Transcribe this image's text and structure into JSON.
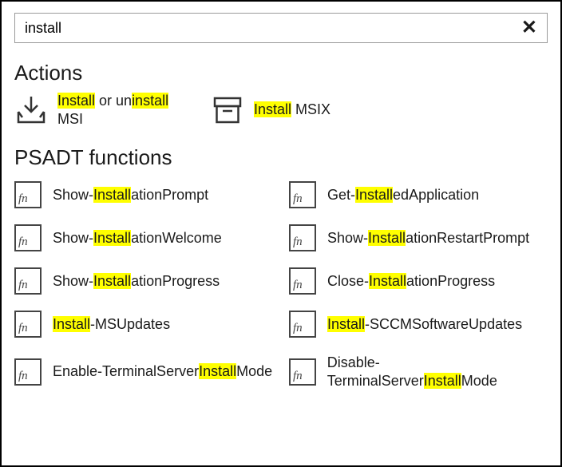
{
  "search": {
    "value": "install",
    "clear_glyph": "✕"
  },
  "sections": {
    "actions_title": "Actions",
    "functions_title": "PSADT functions"
  },
  "highlight": "install",
  "actions": [
    {
      "label": "Install or uninstall MSI",
      "icon": "tray-download-icon"
    },
    {
      "label": "Install MSIX",
      "icon": "archive-box-icon"
    }
  ],
  "functions": [
    {
      "label": "Show-InstallationPrompt"
    },
    {
      "label": "Get-InstalledApplication"
    },
    {
      "label": "Show-InstallationWelcome"
    },
    {
      "label": "Show-InstallationRestartPrompt"
    },
    {
      "label": "Show-InstallationProgress"
    },
    {
      "label": "Close-InstallationProgress"
    },
    {
      "label": "Install-MSUpdates"
    },
    {
      "label": "Install-SCCMSoftwareUpdates"
    },
    {
      "label": "Enable-TerminalServerInstallMode"
    },
    {
      "label": "Disable-TerminalServerInstallMode"
    }
  ],
  "fn_icon_text": "fn"
}
